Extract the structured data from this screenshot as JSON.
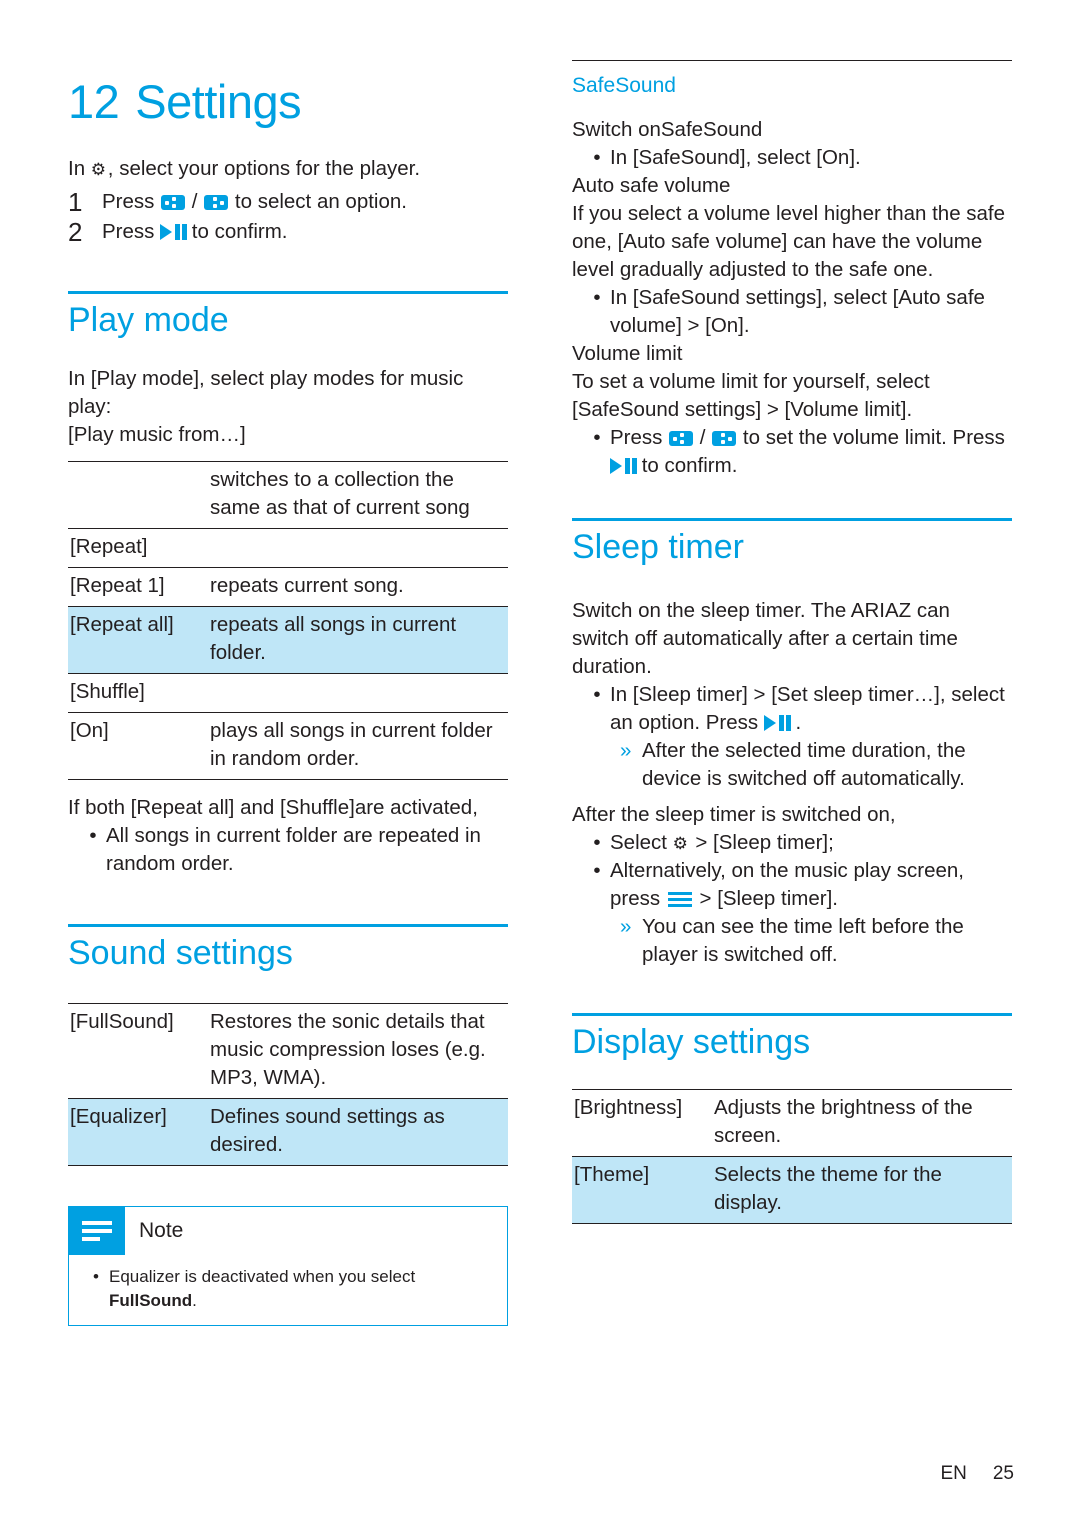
{
  "chapter": {
    "number": "12",
    "title": "Settings"
  },
  "intro": {
    "lead_pre": "In ",
    "lead_post": ", select your options for the player.",
    "step1_pre": "Press ",
    "step1_mid": " / ",
    "step1_post": " to select an option.",
    "step1_num": "1",
    "step2_num": "2",
    "step2_pre": "Press ",
    "step2_post": " to confirm."
  },
  "play_mode": {
    "heading": "Play mode",
    "intro_line1": "In [Play mode], select play modes for music play:",
    "intro_line2": "[Play music from…]",
    "rows": [
      {
        "c1": "",
        "c2": "switches to a collection the same as that of current song",
        "hl": false
      },
      {
        "c1": "[Repeat]",
        "c2": "",
        "hl": false
      },
      {
        "c1": "[Repeat 1]",
        "c2": "repeats current song.",
        "hl": false
      },
      {
        "c1": "[Repeat all]",
        "c2": "repeats all songs in current folder.",
        "hl": true
      },
      {
        "c1": "[Shuffle]",
        "c2": "",
        "hl": false
      },
      {
        "c1": "[On]",
        "c2": "plays all songs in current folder in random order.",
        "hl": false
      }
    ],
    "both_line": "If both [Repeat all] and [Shuffle]are activated,",
    "bullet": "All songs in current folder are repeated in random order."
  },
  "sound_settings": {
    "heading": "Sound settings",
    "rows": [
      {
        "c1": "[FullSound]",
        "c2": "Restores the sonic details that music compression loses (e.g. MP3, WMA).",
        "hl": false
      },
      {
        "c1": "[Equalizer]",
        "c2": "Defines sound settings as desired.",
        "hl": true
      }
    ],
    "note": {
      "title": "Note",
      "text_pre": "Equalizer is deactivated when you select ",
      "text_bold": "FullSound",
      "text_post": "."
    }
  },
  "safesound": {
    "heading": "SafeSound",
    "switch_on_title": "Switch onSafeSound",
    "switch_on_bullet": "In [SafeSound], select [On].",
    "auto_safe_volume": {
      "title": "Auto safe volume",
      "body": "If you select a volume level higher than the safe one, [Auto safe volume] can have the volume level gradually adjusted to the safe one.",
      "bullet": "In [SafeSound settings], select [Auto safe volume] > [On]."
    },
    "volume_limit": {
      "title": "Volume limit",
      "body": "To set a volume limit for yourself, select [SafeSound settings] > [Volume limit].",
      "bullet_pre": "Press ",
      "bullet_mid": " / ",
      "bullet_post": " to set the volume limit. Press ",
      "bullet_end": " to confirm."
    }
  },
  "sleep_timer": {
    "heading": "Sleep timer",
    "body": "Switch on the sleep timer. The ARIAZ can switch off automatically after a certain time duration.",
    "bullet1_pre": "In [Sleep timer] > [Set sleep timer…], select an option. Press ",
    "bullet1_post": " .",
    "arrow1": "After the selected time duration, the device is switched off automatically.",
    "after_title": "After the sleep timer is switched on,",
    "bullet2_pre": "Select ",
    "bullet2_post": " > [Sleep timer];",
    "bullet3_pre": "Alternatively, on the music play screen, press ",
    "bullet3_post": " > [Sleep timer].",
    "arrow2": "You can see the time left before the player is switched off."
  },
  "display_settings": {
    "heading": "Display settings",
    "rows": [
      {
        "c1": "[Brightness]",
        "c2": "Adjusts the brightness of the screen.",
        "hl": false
      },
      {
        "c1": "[Theme]",
        "c2": "Selects the theme for the display.",
        "hl": true
      }
    ]
  },
  "footer": {
    "lang": "EN",
    "page": "25"
  }
}
